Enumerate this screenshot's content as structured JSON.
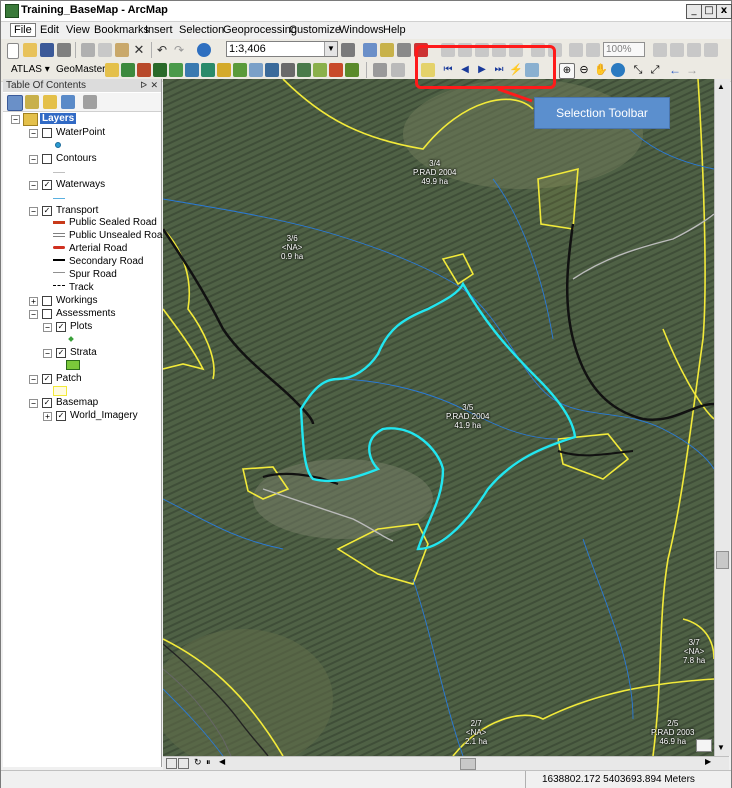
{
  "window": {
    "title": "Training_BaseMap - ArcMap",
    "minimize": "_",
    "maximize": "□",
    "close": "x"
  },
  "menu": [
    "File",
    "Edit",
    "View",
    "Bookmarks",
    "Insert",
    "Selection",
    "Geoprocessing",
    "Customize",
    "Windows",
    "Help"
  ],
  "toolbar": {
    "scale": "1:3,406",
    "zoom_percent": "100%",
    "atlas_label": "ATLAS ▾",
    "geomaster_label": "GeoMaster ▾"
  },
  "toc": {
    "title": "Table Of Contents",
    "layers_root": "Layers",
    "items": [
      {
        "label": "WaterPoint",
        "checked": false
      },
      {
        "label": "Contours",
        "checked": false
      },
      {
        "label": "Waterways",
        "checked": true
      },
      {
        "label": "Transport",
        "checked": true
      },
      {
        "label": "Public Sealed Road"
      },
      {
        "label": "Public Unsealed Road"
      },
      {
        "label": "Arterial Road"
      },
      {
        "label": "Secondary Road"
      },
      {
        "label": "Spur Road"
      },
      {
        "label": "Track"
      },
      {
        "label": "Workings",
        "checked": false
      },
      {
        "label": "Assessments",
        "checked": false
      },
      {
        "label": "Plots",
        "checked": true
      },
      {
        "label": "Strata",
        "checked": true
      },
      {
        "label": "Patch",
        "checked": true
      },
      {
        "label": "Basemap",
        "checked": true
      },
      {
        "label": "World_Imagery",
        "checked": true
      }
    ]
  },
  "callout": {
    "text": "Selection Toolbar"
  },
  "map_labels": [
    {
      "l1": "3/4",
      "l2": "P.RAD 2004",
      "l3": "49.9 ha"
    },
    {
      "l1": "3/6",
      "l2": "<NA>",
      "l3": "0.9 ha"
    },
    {
      "l1": "3/5",
      "l2": "P.RAD 2004",
      "l3": "41.9 ha"
    },
    {
      "l1": "3/7",
      "l2": "<NA>",
      "l3": "7.8 ha"
    },
    {
      "l1": "2/7",
      "l2": "<NA>",
      "l3": "2.1 ha"
    },
    {
      "l1": "2/5",
      "l2": "P.RAD 2003",
      "l3": "46.9 ha"
    }
  ],
  "status": {
    "coords": "1638802.172  5403693.894 Meters"
  },
  "colors": {
    "selection_box": "#ff1a1a",
    "callout_bg": "#5b8fce",
    "selected_polygon": "#22e6f0",
    "patch_outline": "#f2ea3a"
  }
}
